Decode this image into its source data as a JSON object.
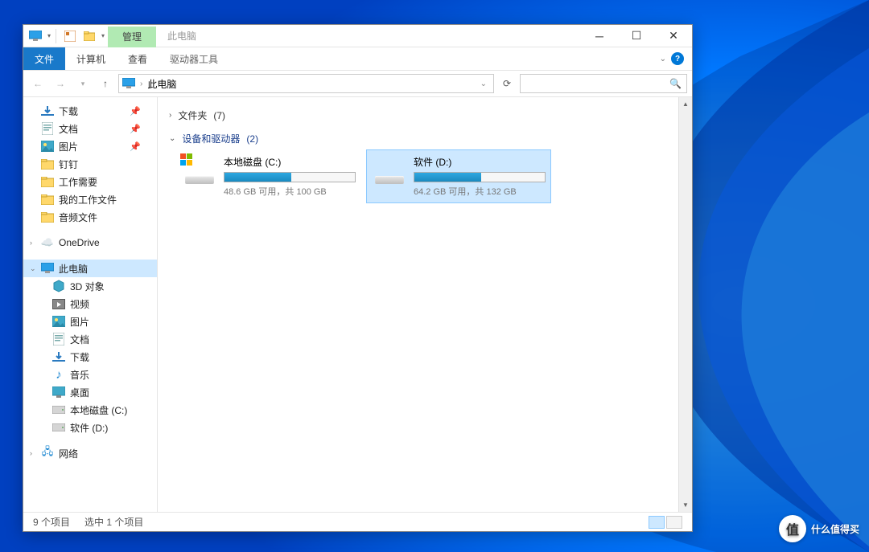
{
  "window": {
    "title": "此电脑",
    "context_tab": "管理",
    "context_group": "驱动器工具"
  },
  "tabs": {
    "file": "文件",
    "computer": "计算机",
    "view": "查看"
  },
  "address": {
    "location": "此电脑"
  },
  "sidebar": {
    "quick": [
      {
        "label": "下载",
        "icon": "download",
        "pinned": true
      },
      {
        "label": "文档",
        "icon": "doc",
        "pinned": true
      },
      {
        "label": "图片",
        "icon": "pic",
        "pinned": true
      },
      {
        "label": "钉钉",
        "icon": "folder",
        "pinned": false
      },
      {
        "label": "工作需要",
        "icon": "folder",
        "pinned": false
      },
      {
        "label": "我的工作文件",
        "icon": "folder",
        "pinned": false
      },
      {
        "label": "音频文件",
        "icon": "folder",
        "pinned": false
      }
    ],
    "onedrive": "OneDrive",
    "thispc": {
      "label": "此电脑",
      "selected": true
    },
    "pcitems": [
      {
        "label": "3D 对象",
        "icon": "3d"
      },
      {
        "label": "视频",
        "icon": "video"
      },
      {
        "label": "图片",
        "icon": "pic"
      },
      {
        "label": "文档",
        "icon": "doc"
      },
      {
        "label": "下载",
        "icon": "download"
      },
      {
        "label": "音乐",
        "icon": "music"
      },
      {
        "label": "桌面",
        "icon": "desktop"
      },
      {
        "label": "本地磁盘 (C:)",
        "icon": "drive"
      },
      {
        "label": "软件 (D:)",
        "icon": "drive"
      }
    ],
    "network": "网络"
  },
  "main": {
    "folders": {
      "label": "文件夹",
      "count": "(7)"
    },
    "devices": {
      "label": "设备和驱动器",
      "count": "(2)"
    },
    "drives": [
      {
        "name": "本地磁盘 (C:)",
        "stat": "48.6 GB 可用，共 100 GB",
        "pct": 51,
        "system": true,
        "selected": false
      },
      {
        "name": "软件 (D:)",
        "stat": "64.2 GB 可用，共 132 GB",
        "pct": 51,
        "system": false,
        "selected": true
      }
    ]
  },
  "status": {
    "count": "9 个项目",
    "selection": "选中 1 个项目"
  },
  "watermark": "什么值得买"
}
